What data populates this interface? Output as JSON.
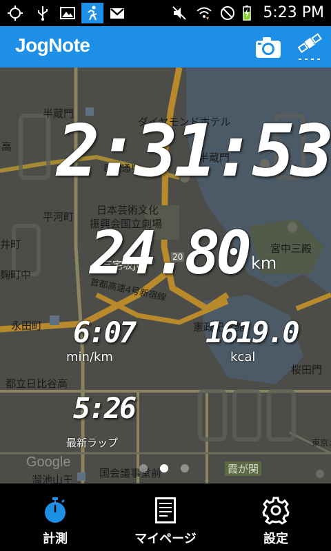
{
  "status_bar": {
    "time": "5:23 PM",
    "icons": [
      "gps-icon",
      "usb-icon",
      "image-icon",
      "jogger-icon",
      "gmail-icon",
      "mute-icon",
      "wifi-icon",
      "no-sim-icon",
      "battery-charging-icon"
    ]
  },
  "app_bar": {
    "title": "JogNote",
    "icons": [
      "camera-icon",
      "satellite-icon"
    ],
    "accent_color": "#1e8fe6"
  },
  "map": {
    "labels": [
      "半蔵門",
      "ダイヤモンドホテル",
      "新宿通り",
      "半蔵門",
      "高",
      "日本芸術文化",
      "振興会国立劇場",
      "平河町",
      "井町",
      "宮中三殿",
      "三宅坂JCT",
      "麹町中",
      "首都高速4号新宿線",
      "永田町",
      "憲政記念館",
      "都立日比谷高",
      "桜田門",
      "霞が関",
      "国会議事堂前",
      "溜池山王",
      "Google",
      "東京メ",
      "20"
    ]
  },
  "stats": {
    "elapsed_time": "2:31:53",
    "distance": "24.80",
    "distance_unit": "km",
    "pace": "6:07",
    "pace_unit": "min/km",
    "calories": "1619.0",
    "calories_unit": "kcal",
    "lap_time": "5:26",
    "lap_label": "最新ラップ"
  },
  "pager": {
    "count": 3,
    "active_index": 1
  },
  "bottom_nav": {
    "items": [
      {
        "label": "計測",
        "icon": "stopwatch-icon",
        "active": true
      },
      {
        "label": "マイページ",
        "icon": "document-icon",
        "active": false
      },
      {
        "label": "設定",
        "icon": "gear-icon",
        "active": false
      }
    ]
  }
}
